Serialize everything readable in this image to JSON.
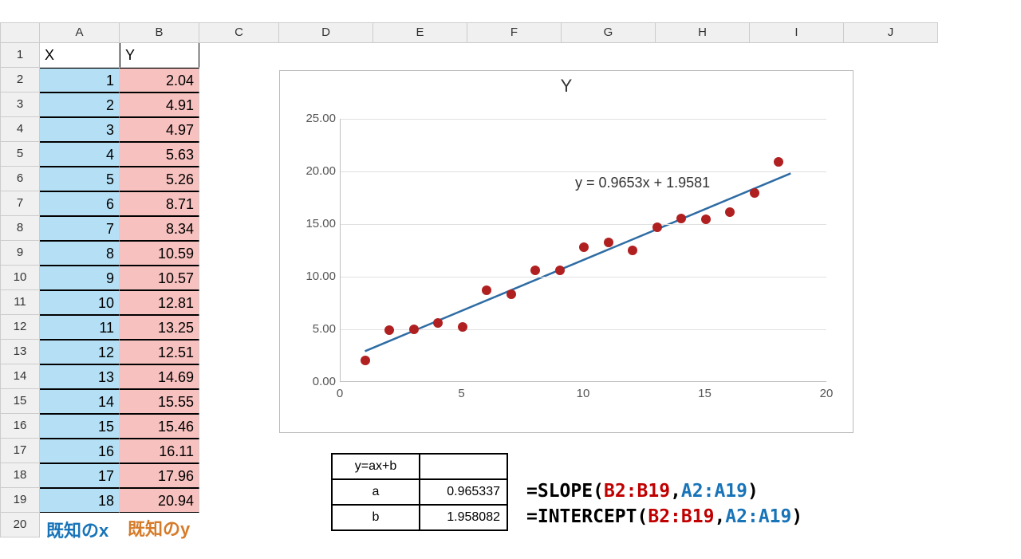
{
  "columns": [
    "A",
    "B",
    "C",
    "D",
    "E",
    "F",
    "G",
    "H",
    "I",
    "J"
  ],
  "headerA": "X",
  "headerB": "Y",
  "rows": [
    {
      "x": "1",
      "y": "2.04"
    },
    {
      "x": "2",
      "y": "4.91"
    },
    {
      "x": "3",
      "y": "4.97"
    },
    {
      "x": "4",
      "y": "5.63"
    },
    {
      "x": "5",
      "y": "5.26"
    },
    {
      "x": "6",
      "y": "8.71"
    },
    {
      "x": "7",
      "y": "8.34"
    },
    {
      "x": "8",
      "y": "10.59"
    },
    {
      "x": "9",
      "y": "10.57"
    },
    {
      "x": "10",
      "y": "12.81"
    },
    {
      "x": "11",
      "y": "13.25"
    },
    {
      "x": "12",
      "y": "12.51"
    },
    {
      "x": "13",
      "y": "14.69"
    },
    {
      "x": "14",
      "y": "15.55"
    },
    {
      "x": "15",
      "y": "15.46"
    },
    {
      "x": "16",
      "y": "16.11"
    },
    {
      "x": "17",
      "y": "17.96"
    },
    {
      "x": "18",
      "y": "20.94"
    }
  ],
  "label_known_x": "既知のx",
  "label_known_y": "既知のy",
  "formula_table": {
    "header": "y=ax+b",
    "a_label": "a",
    "a_val": "0.965337",
    "b_label": "b",
    "b_val": "1.958082"
  },
  "slope_formula": {
    "fn": "SLOPE",
    "arg1": "B2:B19",
    "arg2": "A2:A19"
  },
  "intercept_formula": {
    "fn": "INTERCEPT",
    "arg1": "B2:B19",
    "arg2": "A2:A19"
  },
  "chart_data": {
    "type": "scatter",
    "title": "Y",
    "x": [
      1,
      2,
      3,
      4,
      5,
      6,
      7,
      8,
      9,
      10,
      11,
      12,
      13,
      14,
      15,
      16,
      17,
      18
    ],
    "y": [
      2.04,
      4.91,
      4.97,
      5.63,
      5.26,
      8.71,
      8.34,
      10.59,
      10.57,
      12.81,
      13.25,
      12.51,
      14.69,
      15.55,
      15.46,
      16.11,
      17.96,
      20.94
    ],
    "trendline": {
      "slope": 0.9653,
      "intercept": 1.9581
    },
    "equation_label": "y = 0.9653x + 1.9581",
    "xlim": [
      0,
      20
    ],
    "ylim": [
      0,
      25
    ],
    "xticks": [
      0,
      5,
      10,
      15,
      20
    ],
    "yticks": [
      "0.00",
      "5.00",
      "10.00",
      "15.00",
      "20.00",
      "25.00"
    ]
  }
}
